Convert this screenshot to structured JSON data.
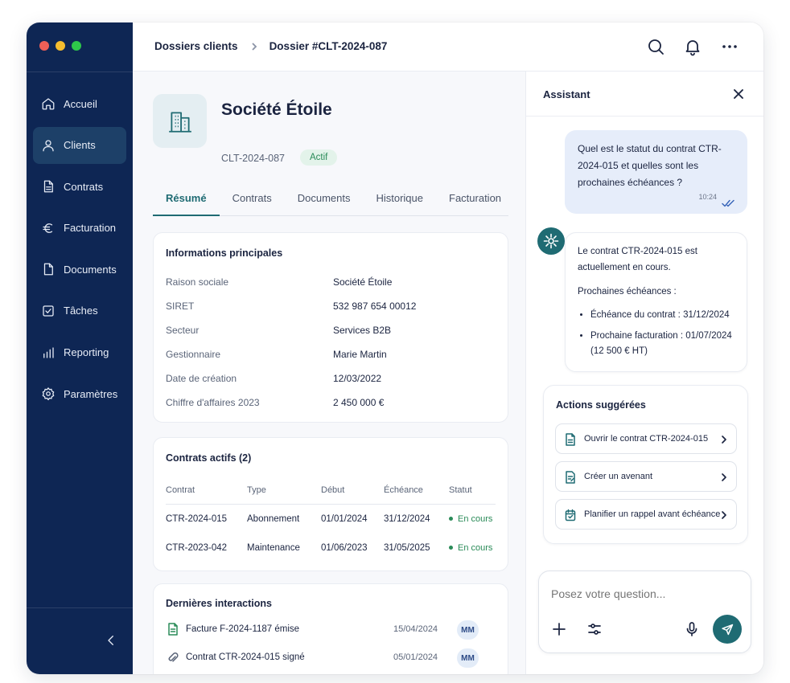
{
  "colors": {
    "sidebar": "#0e2654",
    "accent": "#1f6b73",
    "success": "#2a8b58",
    "traffic_red": "#ee5f57",
    "traffic_yellow": "#f5bd2f",
    "traffic_green": "#2ec74a"
  },
  "sidebar": {
    "items": [
      {
        "label": "Accueil",
        "icon": "home-icon"
      },
      {
        "label": "Clients",
        "icon": "user-icon",
        "active": true
      },
      {
        "label": "Contrats",
        "icon": "file-text-icon"
      },
      {
        "label": "Facturation",
        "icon": "euro-icon"
      },
      {
        "label": "Documents",
        "icon": "document-icon"
      },
      {
        "label": "Tâches",
        "icon": "checkbox-icon"
      },
      {
        "label": "Reporting",
        "icon": "bar-chart-icon"
      },
      {
        "label": "Paramètres",
        "icon": "gear-icon"
      }
    ],
    "collapse_icon": "chevron-left-icon"
  },
  "topbar": {
    "breadcrumb": [
      "Dossiers clients",
      "Dossier #CLT-2024-087"
    ],
    "icons": [
      "search-icon",
      "bell-icon",
      "more-horizontal-icon"
    ]
  },
  "client": {
    "name": "Société Étoile",
    "id": "CLT-2024-087",
    "status": "Actif",
    "logo_icon": "building-icon"
  },
  "tabs": [
    "Résumé",
    "Contrats",
    "Documents",
    "Historique",
    "Facturation"
  ],
  "active_tab": "Résumé",
  "info_card": {
    "title": "Informations principales",
    "rows": [
      {
        "label": "Raison sociale",
        "value": "Société Étoile"
      },
      {
        "label": "SIRET",
        "value": "532 987 654 00012"
      },
      {
        "label": "Secteur",
        "value": "Services B2B"
      },
      {
        "label": "Gestionnaire",
        "value": "Marie Martin"
      },
      {
        "label": "Date de création",
        "value": "12/03/2022"
      },
      {
        "label": "Chiffre d'affaires 2023",
        "value": "2 450 000 €"
      }
    ]
  },
  "contracts_card": {
    "title": "Contrats actifs (2)",
    "headers": [
      "Contrat",
      "Type",
      "Début",
      "Échéance",
      "Statut"
    ],
    "rows": [
      [
        "CTR-2024-015",
        "Abonnement",
        "01/01/2024",
        "31/12/2024",
        "En cours"
      ],
      [
        "CTR-2023-042",
        "Maintenance",
        "01/06/2023",
        "31/05/2025",
        "En cours"
      ]
    ]
  },
  "interactions_card": {
    "title": "Dernières interactions",
    "rows": [
      {
        "label": "Facture F-2024-1187 émise",
        "date": "15/04/2024",
        "avatar": "MM",
        "icon": "invoice-icon"
      },
      {
        "label": "Contrat CTR-2024-015 signé",
        "date": "05/01/2024",
        "avatar": "MM",
        "icon": "paperclip-icon"
      }
    ]
  },
  "assistant": {
    "title": "Assistant",
    "user_message": "Quel est le statut du contrat CTR-2024-015 et quelles sont les prochaines échéances ?",
    "user_time": "10:24",
    "bot_message": {
      "intro": "Le contrat CTR-2024-015 est actuellement en cours.",
      "list_title": "Prochaines échéances :",
      "items": [
        "Échéance du contrat : 31/12/2024",
        "Prochaine facturation : 01/07/2024 (12 500 € HT)"
      ]
    },
    "actions_title": "Actions suggérées",
    "actions": [
      {
        "label": "Ouvrir le contrat CTR-2024-015",
        "icon": "file-icon"
      },
      {
        "label": "Créer un avenant",
        "icon": "edit-file-icon"
      },
      {
        "label": "Planifier un rappel avant échéance",
        "icon": "calendar-icon"
      }
    ],
    "composer": {
      "placeholder": "Posez votre question...",
      "icons": [
        "plus-icon",
        "settings-sliders-icon",
        "microphone-icon",
        "send-icon"
      ]
    }
  }
}
